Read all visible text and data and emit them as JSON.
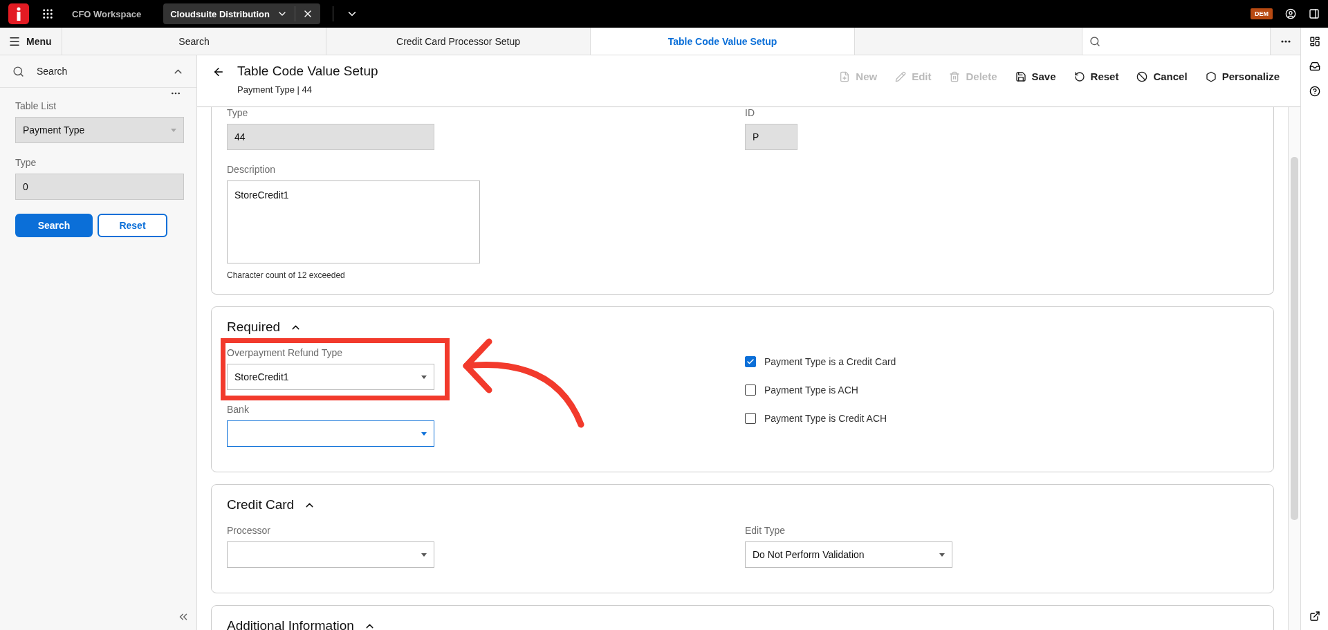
{
  "top_bar": {
    "app_title": "CFO Workspace",
    "workspace_tab": "Cloudsuite Distribution",
    "user_badge": "DEM"
  },
  "tab_bar": {
    "menu_label": "Menu",
    "tabs": [
      {
        "label": "Search",
        "selected": false
      },
      {
        "label": "Credit Card Processor Setup",
        "selected": false
      },
      {
        "label": "Table Code Value Setup",
        "selected": true
      }
    ]
  },
  "sidebar": {
    "search_title": "Search",
    "expanded": true,
    "fields": [
      {
        "label": "Table List",
        "value": "Payment Type",
        "kind": "dropdown"
      },
      {
        "label": "Type",
        "value": "0",
        "kind": "text"
      }
    ],
    "buttons": [
      {
        "label": "Search",
        "kind": "primary"
      },
      {
        "label": "Reset",
        "kind": "secondary"
      }
    ]
  },
  "header": {
    "title": "Table Code Value Setup",
    "subtitle": "Payment Type | 44",
    "actions": [
      {
        "label": "New",
        "disabled": true
      },
      {
        "label": "Edit",
        "disabled": true
      },
      {
        "label": "Delete",
        "disabled": true
      },
      {
        "label": "Save",
        "disabled": false
      },
      {
        "label": "Reset",
        "disabled": false
      },
      {
        "label": "Cancel",
        "disabled": false
      },
      {
        "label": "Personalize",
        "disabled": false
      }
    ]
  },
  "sections": [
    {
      "left": [
        {
          "kind": "readonly",
          "label": "Type",
          "value": "44"
        },
        {
          "kind": "textarea",
          "label": "Description",
          "value": "StoreCredit1",
          "hint": "Character count of 12 exceeded"
        }
      ],
      "right": [
        {
          "kind": "readonly_small",
          "label": "ID",
          "value": "P"
        }
      ]
    },
    {
      "title": "Required",
      "expanded": true,
      "left": [
        {
          "kind": "dropdown",
          "label": "Overpayment Refund Type",
          "value": "StoreCredit1",
          "focused": false,
          "highlighted": true
        },
        {
          "kind": "dropdown",
          "label": "Bank",
          "focused": true,
          "highlighted": false
        }
      ],
      "right": [
        {
          "kind": "checkbox",
          "label": "Payment Type is a Credit Card",
          "checked": true
        },
        {
          "kind": "checkbox",
          "label": "Payment Type is ACH",
          "checked": false
        },
        {
          "kind": "checkbox",
          "label": "Payment Type is Credit ACH",
          "checked": false
        }
      ]
    },
    {
      "title": "Credit Card",
      "expanded": true,
      "left": [
        {
          "kind": "dropdown",
          "label": "Processor",
          "focused": false
        }
      ],
      "right": [
        {
          "kind": "dropdown",
          "label": "Edit Type",
          "value": "Do Not Perform Validation",
          "focused": false
        }
      ]
    },
    {
      "title": "Additional Information",
      "expanded": true
    }
  ]
}
